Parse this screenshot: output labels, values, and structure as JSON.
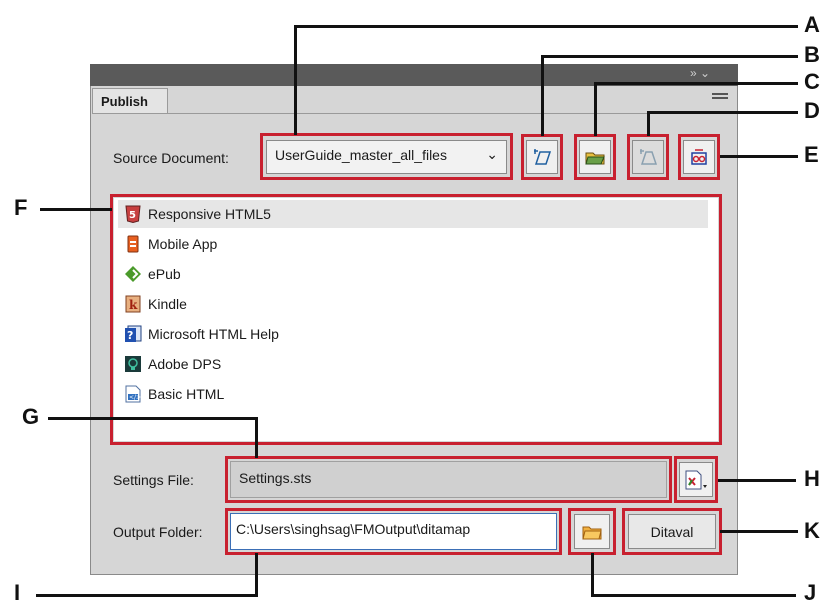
{
  "panel": {
    "tab_label": "Publish",
    "window_controls": "»  ⌄"
  },
  "source": {
    "label": "Source Document:",
    "value": "UserGuide_master_all_files"
  },
  "outputs": [
    {
      "label": "Responsive HTML5",
      "icon": "html5-icon"
    },
    {
      "label": "Mobile App",
      "icon": "mobile-app-icon"
    },
    {
      "label": "ePub",
      "icon": "epub-icon"
    },
    {
      "label": "Kindle",
      "icon": "kindle-icon"
    },
    {
      "label": "Microsoft HTML Help",
      "icon": "html-help-icon"
    },
    {
      "label": "Adobe DPS",
      "icon": "adobe-dps-icon"
    },
    {
      "label": "Basic HTML",
      "icon": "basic-html-icon"
    }
  ],
  "settings": {
    "label": "Settings File:",
    "value": "Settings.sts"
  },
  "output_folder": {
    "label": "Output Folder:",
    "value": "C:\\Users\\singhsag\\FMOutput\\ditamap"
  },
  "ditaval_button": "Ditaval",
  "callouts": [
    "A",
    "B",
    "C",
    "D",
    "E",
    "F",
    "G",
    "H",
    "I",
    "J",
    "K"
  ],
  "colors": {
    "highlight": "#c8202f",
    "panel_bg": "#d6d6d6",
    "titlebar": "#5a5a5a"
  }
}
